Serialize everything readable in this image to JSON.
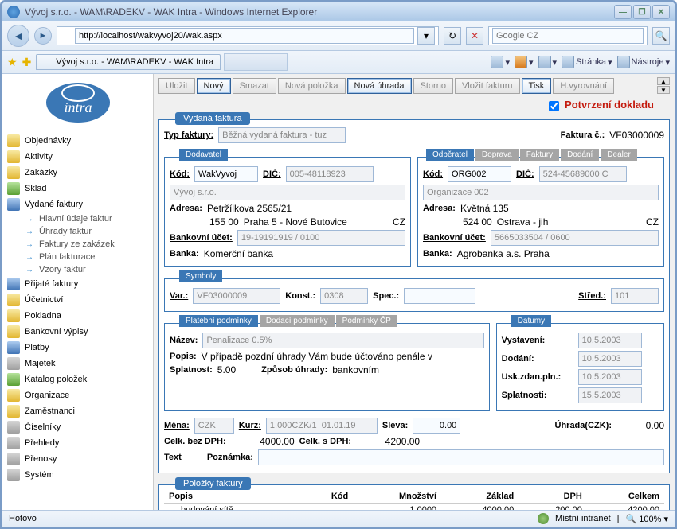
{
  "window": {
    "title": "Vývoj s.r.o. - WAM\\RADEKV - WAK Intra - Windows Internet Explorer"
  },
  "address": {
    "url": "http://localhost/wakvyvoj20/wak.aspx",
    "search_placeholder": "Google CZ"
  },
  "tab": {
    "title": "Vývoj s.r.o. - WAM\\RADEKV - WAK Intra"
  },
  "ie_toolbar": {
    "page": "Stránka",
    "tools": "Nástroje"
  },
  "sidebar": {
    "items": [
      {
        "label": "Objednávky",
        "type": "folder"
      },
      {
        "label": "Aktivity",
        "type": "folder"
      },
      {
        "label": "Zakázky",
        "type": "folder"
      },
      {
        "label": "Sklad",
        "type": "green"
      },
      {
        "label": "Vydané faktury",
        "type": "blue"
      },
      {
        "label": "Hlavní údaje faktur",
        "sub": true
      },
      {
        "label": "Úhrady faktur",
        "sub": true
      },
      {
        "label": "Faktury ze zakázek",
        "sub": true
      },
      {
        "label": "Plán fakturace",
        "sub": true
      },
      {
        "label": "Vzory faktur",
        "sub": true
      },
      {
        "label": "Přijaté faktury",
        "type": "blue"
      },
      {
        "label": "Účetnictví",
        "type": "folder"
      },
      {
        "label": "Pokladna",
        "type": "folder"
      },
      {
        "label": "Bankovní výpisy",
        "type": "folder"
      },
      {
        "label": "Platby",
        "type": "blue"
      },
      {
        "label": "Majetek",
        "type": "grey"
      },
      {
        "label": "Katalog položek",
        "type": "green"
      },
      {
        "label": "Organizace",
        "type": "folder"
      },
      {
        "label": "Zaměstnanci",
        "type": "folder"
      },
      {
        "label": "Číselníky",
        "type": "grey"
      },
      {
        "label": "Přehledy",
        "type": "grey"
      },
      {
        "label": "Přenosy",
        "type": "grey"
      },
      {
        "label": "Systém",
        "type": "grey"
      }
    ]
  },
  "form_toolbar": [
    "Uložit",
    "Nový",
    "Smazat",
    "Nová položka",
    "Nová úhrada",
    "Storno",
    "Vložit fakturu",
    "Tisk",
    "H.vyrovnání"
  ],
  "confirm": {
    "label": "Potvrzení dokladu"
  },
  "invoice": {
    "section": "Vydaná faktura",
    "type_label": "Typ faktury:",
    "type_value": "Běžná vydaná faktura - tuz",
    "num_label": "Faktura č.:",
    "num_value": "VF03000009"
  },
  "supplier": {
    "section": "Dodavatel",
    "code_label": "Kód:",
    "code": "WakVyvoj",
    "dic_label": "DIČ:",
    "dic": "005-48118923",
    "name": "Vývoj s.r.o.",
    "addr_label": "Adresa:",
    "street": "Petržílkova 2565/21",
    "zip": "155 00",
    "city": "Praha 5 - Nové Butovice",
    "country": "CZ",
    "bank_acc_label": "Bankovní účet:",
    "bank_acc": "19-19191919 / 0100",
    "bank_label": "Banka:",
    "bank": "Komerční banka"
  },
  "buyer": {
    "tabs": [
      "Odběratel",
      "Doprava",
      "Faktury",
      "Dodání",
      "Dealer"
    ],
    "code_label": "Kód:",
    "code": "ORG002",
    "dic_label": "DIČ:",
    "dic": "524-45689000 C",
    "name": "Organizace 002",
    "addr_label": "Adresa:",
    "street": "Květná 135",
    "zip": "524 00",
    "city": "Ostrava - jih",
    "country": "CZ",
    "bank_acc_label": "Bankovní účet:",
    "bank_acc": "5665033504 / 0600",
    "bank_label": "Banka:",
    "bank": "Agrobanka a.s. Praha"
  },
  "symbols": {
    "section": "Symboly",
    "var_label": "Var.:",
    "var": "VF03000009",
    "konst_label": "Konst.:",
    "konst": "0308",
    "spec_label": "Spec.:",
    "spec": "",
    "stred_label": "Střed.:",
    "stred": "101"
  },
  "terms": {
    "tabs": [
      "Platební podmínky",
      "Dodací podmínky",
      "Podmínky ČP"
    ],
    "name_label": "Název:",
    "name": "Penalizace 0.5%",
    "desc_label": "Popis:",
    "desc": "V případě pozdní úhrady Vám bude účtováno penále v",
    "due_label": "Splatnost:",
    "due": "5.00",
    "method_label": "Způsob úhrady:",
    "method": "bankovním"
  },
  "dates": {
    "section": "Datumy",
    "issue_label": "Vystavení:",
    "issue": "10.5.2003",
    "delivery_label": "Dodání:",
    "delivery": "10.5.2003",
    "tax_label": "Usk.zdan.pln.:",
    "tax": "10.5.2003",
    "due_label": "Splatnosti:",
    "due": "15.5.2003"
  },
  "totals": {
    "currency_label": "Měna:",
    "currency": "CZK",
    "rate_label": "Kurz:",
    "rate": "1.000CZK/1  01.01.19",
    "discount_label": "Sleva:",
    "discount": "0.00",
    "net_label": "Celk. bez DPH:",
    "net": "4000.00",
    "gross_label": "Celk. s DPH:",
    "gross": "4200.00",
    "paid_label": "Úhrada(CZK):",
    "paid": "0.00",
    "text_label": "Text",
    "note_label": "Poznámka:"
  },
  "items": {
    "section": "Položky faktury",
    "cols": [
      "Popis",
      "Kód",
      "Množství",
      "Základ",
      "DPH",
      "Celkem"
    ],
    "rows": [
      {
        "popis": "budování sítě",
        "kod": "",
        "mnozstvi": "1.0000",
        "zaklad": "4000.00",
        "dph": "200.00",
        "celkem": "4200.00"
      }
    ]
  },
  "status": {
    "done": "Hotovo",
    "zone": "Místní intranet",
    "zoom": "100%"
  }
}
